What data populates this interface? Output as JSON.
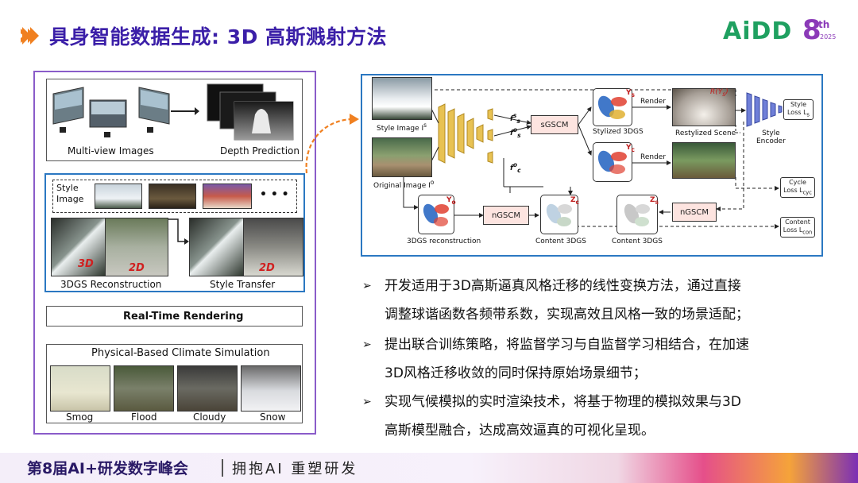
{
  "header": {
    "title": "具身智能数据生成: 3D 高斯溅射方法",
    "logo_text": "AiDD",
    "logo_number": "8",
    "logo_sup": "th",
    "logo_year": "2025"
  },
  "left_figure": {
    "multi_view_label": "Multi-view Images",
    "depth_label": "Depth Prediction",
    "style_image_label_1": "Style",
    "style_image_label_2": "Image",
    "ellipsis": "• • •",
    "recon_label": "3DGS Reconstruction",
    "transfer_label": "Style Transfer",
    "tag_3d": "3D",
    "tag_2d": "2D",
    "rendering_label": "Real-Time Rendering",
    "climate_label": "Physical-Based Climate Simulation",
    "climates": [
      "Smog",
      "Flood",
      "Cloudy",
      "Snow"
    ]
  },
  "diagram": {
    "style_image": "Style Image I",
    "style_image_sup": "s",
    "original_image": "Original Image I",
    "original_image_sup": "o",
    "sgscm": "sGSCM",
    "ngscm_left": "nGSCM",
    "ngscm_right": "nGSCM",
    "stylized_3dgs": "Stylized 3DGS",
    "restylized_scene": "Restylized Scene",
    "render_1": "Render",
    "render_2": "Render",
    "style_encoder_1": "Style",
    "style_encoder_2": "Encoder",
    "style_loss_1": "Style",
    "style_loss_2": "Loss L",
    "style_loss_sub": "s",
    "cycle_loss_1": "Cycle",
    "cycle_loss_2": "Loss L",
    "cycle_loss_sub": "cyc",
    "content_loss_1": "Content",
    "content_loss_2": "Loss L",
    "content_loss_sub": "con",
    "recon_3dgs": "3DGS reconstruction",
    "content_3dgs_1": "Content 3DGS",
    "content_3dgs_2": "Content 3DGS",
    "y_s": "Y",
    "y_s_sub": "s",
    "y_c": "Y",
    "y_c_sub": "c",
    "y_o": "Y",
    "y_o_sub": "o",
    "z_c": "Z",
    "z_c_sub": "c",
    "z_s": "Z",
    "z_s_sub": "s",
    "f_s_s": "f",
    "f_s_o": "f",
    "f_c_o": "f",
    "r_label": "R(Y",
    "r_label_sub": "s",
    "r_label_end": ")"
  },
  "bullets": [
    {
      "line1": "开发适用于3D高斯逼真风格迁移的线性变换方法，通过直接",
      "line2": "调整球谐函数各频带系数，实现高效且风格一致的场景适配；"
    },
    {
      "line1": "提出联合训练策略，将监督学习与自监督学习相结合，在加速",
      "line2": "3D风格迁移收敛的同时保持原始场景细节；"
    },
    {
      "line1": "实现气候模拟的实时渲染技术，将基于物理的模拟效果与3D",
      "line2": "高斯模型融合，达成高效逼真的可视化呈现。"
    }
  ],
  "bullet_marker": "➢",
  "footer": {
    "main": "第8届AI+研发数字峰会",
    "sub": "拥抱AI 重塑研发"
  },
  "colors": {
    "title": "#3b1fa8",
    "accent_orange": "#f08020",
    "frame_purple": "#8a5cc9",
    "frame_blue": "#2b78c2",
    "logo_green": "#1fa060",
    "logo_purple": "#8b3ab8"
  }
}
